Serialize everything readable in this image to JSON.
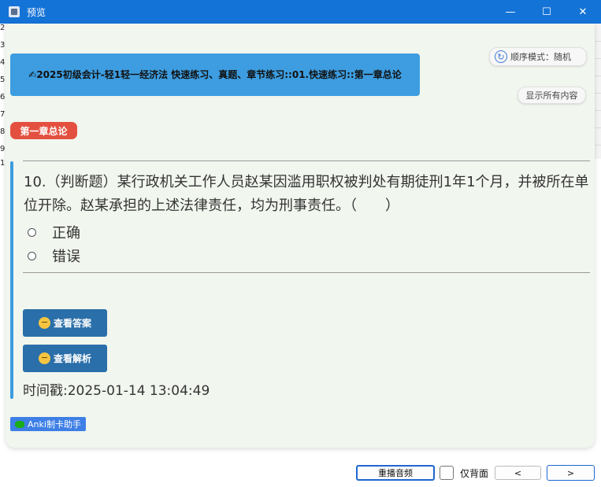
{
  "window": {
    "title": "预览",
    "minimize_glyph": "—",
    "maximize_glyph": "☐",
    "close_glyph": "✕"
  },
  "background_rows": {
    "left_numbers": [
      "2",
      "3",
      "4",
      "5",
      "6",
      "7",
      "8",
      "9",
      "1"
    ]
  },
  "deck": {
    "banner": "✍2025初级会计-轻1轻一经济法 快速练习、真题、章节练习::01.快速练习::第一章总论"
  },
  "order_mode": {
    "icon": "refresh-icon",
    "label": "顺序模式：随机"
  },
  "show_all_label": "显示所有内容",
  "chapter_tag": "第一章总论",
  "question": {
    "text": "10.（判断题）某行政机关工作人员赵某因滥用职权被判处有期徒刑1年1个月，并被所在单位开除。赵某承担的上述法律责任，均为刑事责任。（　　）",
    "options": [
      "正确",
      "错误"
    ]
  },
  "buttons": {
    "show_answer": "查看答案",
    "show_analysis": "查看解析"
  },
  "timestamp": "时间戳:2025-01-14 13:04:49",
  "badge": "Anki制卡助手",
  "bottom": {
    "replay_audio": "重播音频",
    "back_only": "仅背面",
    "prev": "<",
    "next": ">"
  },
  "colors": {
    "titlebar": "#1473d6",
    "banner": "#3d9de0",
    "chapter_tag": "#e4503f",
    "action_button": "#2a6fa9",
    "card_background": "#f1f6ee"
  }
}
